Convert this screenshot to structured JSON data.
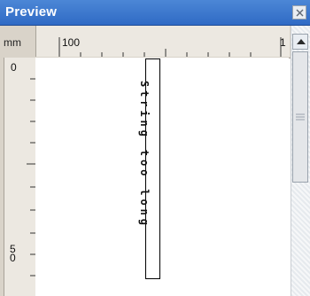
{
  "window": {
    "title": "Preview",
    "icons": {
      "close": "close-icon"
    }
  },
  "ruler": {
    "unit": "mm",
    "horizontal_start_label": "100",
    "horizontal_end_label": "1",
    "vertical_start_label": "0",
    "vertical_label_5": "5\n0"
  },
  "preview": {
    "text": "String too long"
  },
  "colors": {
    "titlebar": "#3a78cf",
    "ruler": "#d9d3c9"
  }
}
